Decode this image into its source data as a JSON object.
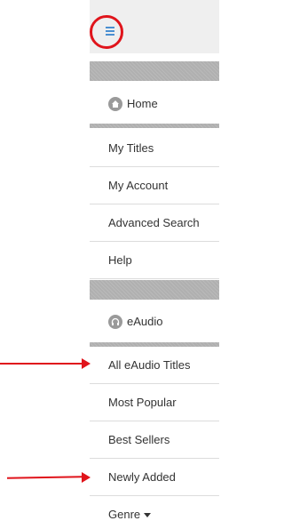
{
  "menu": {
    "icon": "hamburger-menu-icon"
  },
  "sections": {
    "main": {
      "label": "Home",
      "icon": "home-icon"
    },
    "audio": {
      "label": "eAudio",
      "icon": "headphones-icon"
    }
  },
  "main_items": [
    "My Titles",
    "My Account",
    "Advanced Search",
    "Help"
  ],
  "audio_items": [
    "All eAudio Titles",
    "Most Popular",
    "Best Sellers",
    "Newly Added"
  ],
  "genre": {
    "label": "Genre",
    "icon": "caret-down-icon"
  },
  "colors": {
    "accent": "#4a8fd1",
    "annotation": "#e0141b",
    "band": "#b0b0b0",
    "topbar": "#efefef"
  }
}
